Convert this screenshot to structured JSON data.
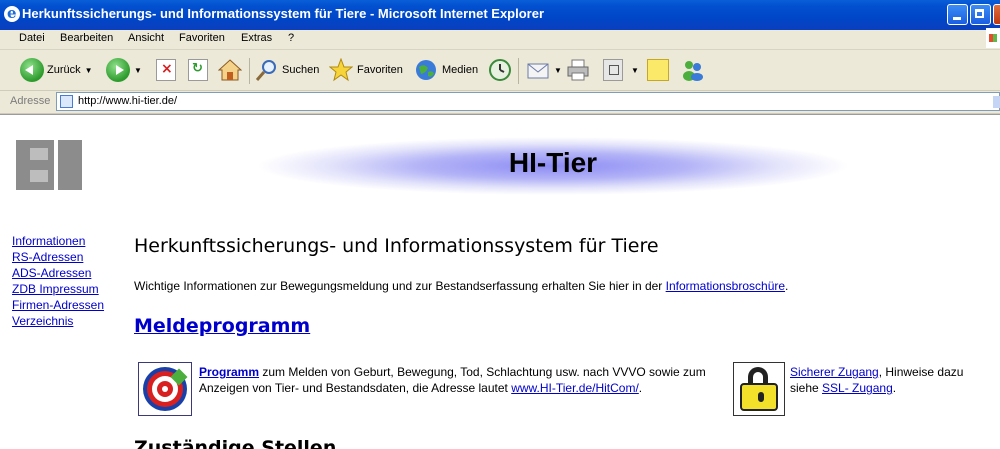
{
  "window": {
    "title": "Herkunftssicherungs- und Informationssystem für Tiere - Microsoft Internet Explorer"
  },
  "menu": [
    "Datei",
    "Bearbeiten",
    "Ansicht",
    "Favoriten",
    "Extras",
    "?"
  ],
  "toolbar": {
    "back_label": "Zurück",
    "search_label": "Suchen",
    "favorites_label": "Favoriten",
    "media_label": "Medien"
  },
  "address": {
    "label": "Adresse",
    "url": "http://www.hi-tier.de/"
  },
  "page": {
    "banner_title": "HI-Tier",
    "nav": [
      "Informationen",
      "RS-Adressen",
      "ADS-Adressen",
      "ZDB Impressum",
      "Firmen-Adressen",
      "Verzeichnis"
    ],
    "heading": "Herkunftssicherungs- und Informationssystem für Tiere",
    "intro_text": "Wichtige Informationen zur Bewegungsmeldung und zur Bestandserfassung erhalten Sie hier in der ",
    "intro_link": "Informationsbroschüre",
    "intro_end": ".",
    "section_title": "Meldeprogramm",
    "program": {
      "link": "Programm",
      "text": " zum Melden von Geburt, Bewegung, Tod, Schlachtung usw. nach VVVO sowie zum Anzeigen von Tier- und Bestandsdaten, die Adresse lautet ",
      "url_link": "www.HI-Tier.de/HitCom/",
      "end": "."
    },
    "ssl": {
      "link": "Sicherer Zugang",
      "text": ", Hinweise dazu siehe ",
      "link2": "SSL- Zugang",
      "end": "."
    },
    "next_heading": "Zuständige Stellen"
  },
  "colors": {
    "titlebar": "#0046c8",
    "link": "#0000cc",
    "banner": "#8d8cf4"
  }
}
